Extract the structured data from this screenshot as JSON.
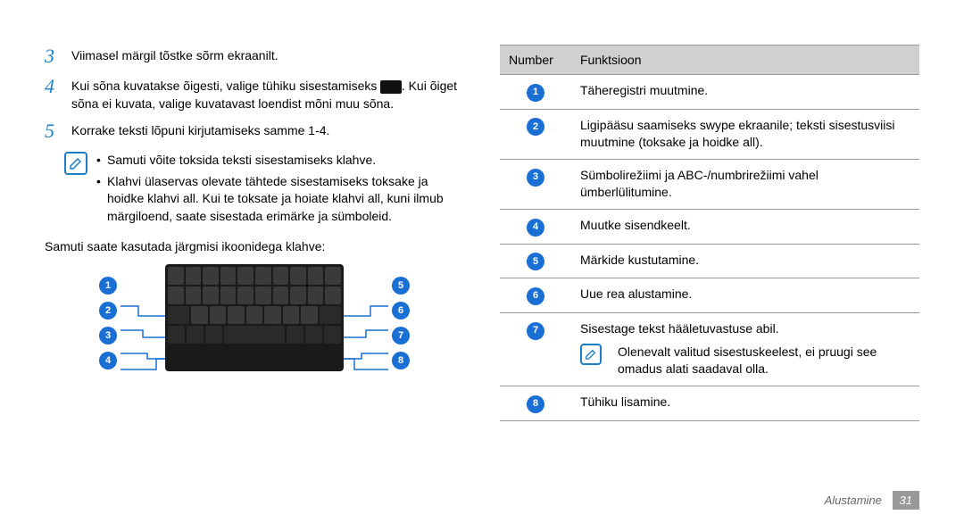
{
  "steps": [
    {
      "num": "3",
      "text": "Viimasel märgil tõstke sõrm ekraanilt."
    },
    {
      "num": "4",
      "text_pre": "Kui sõna kuvatakse õigesti, valige tühiku sisestamiseks ",
      "text_post": ". Kui õiget sõna ei kuvata, valige kuvatavast loendist mõni muu sõna."
    },
    {
      "num": "5",
      "text": "Korrake teksti lõpuni kirjutamiseks samme 1-4."
    }
  ],
  "note_items": [
    "Samuti võite toksida teksti sisestamiseks klahve.",
    "Klahvi ülaservas olevate tähtede sisestamiseks toksake ja hoidke klahvi all. Kui te toksate ja hoiate klahvi all, kuni ilmub märgiloend, saate sisestada erimärke ja sümboleid."
  ],
  "para": "Samuti saate kasutada järgmisi ikoonidega klahve:",
  "callouts_left": [
    "1",
    "2",
    "3",
    "4"
  ],
  "callouts_right": [
    "5",
    "6",
    "7",
    "8"
  ],
  "table": {
    "head_num": "Number",
    "head_fn": "Funktsioon",
    "rows": [
      {
        "n": "1",
        "fn": "Täheregistri muutmine."
      },
      {
        "n": "2",
        "fn": "Ligipääsu saamiseks swype ekraanile; teksti sisestusviisi muutmine (toksake ja hoidke all)."
      },
      {
        "n": "3",
        "fn": "Sümbolirežiimi ja ABC-/numbrirežiimi vahel ümberlülitumine."
      },
      {
        "n": "4",
        "fn": "Muutke sisendkeelt."
      },
      {
        "n": "5",
        "fn": "Märkide kustutamine."
      },
      {
        "n": "6",
        "fn": "Uue rea alustamine."
      },
      {
        "n": "7",
        "fn": "Sisestage tekst hääletuvastuse abil.",
        "note": "Olenevalt valitud sisestuskeelest, ei pruugi see omadus alati saadaval olla."
      },
      {
        "n": "8",
        "fn": "Tühiku lisamine."
      }
    ]
  },
  "footer": {
    "section": "Alustamine",
    "page": "31"
  }
}
